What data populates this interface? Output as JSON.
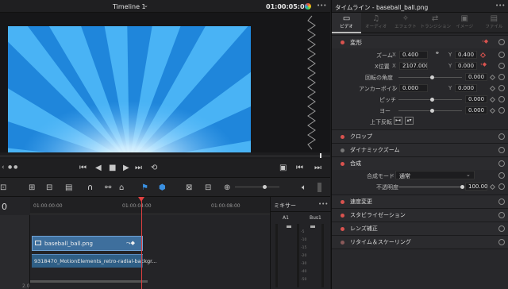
{
  "viewer": {
    "timeline_name": "Timeline 1",
    "timecode": "01:00:05:00",
    "more": "•••"
  },
  "transport": {
    "nav_left": "‹",
    "nav_dots": "● ●"
  },
  "timeline": {
    "current_tc": "0",
    "ruler": [
      "01:00:00:00",
      "01:00:04:00",
      "01:00:08:00"
    ],
    "clip_video": "baseball_ball.png",
    "clip_audio": "9318470_MotionElements_retro-radial-backgr...",
    "track_audio_label": "2.0"
  },
  "mixer": {
    "title": "ミキサー",
    "more": "•••",
    "ch1": "A1",
    "ch2": "Bus1",
    "scale": [
      "-5",
      "-10",
      "-15",
      "-20",
      "-30",
      "-40",
      "-50"
    ]
  },
  "inspector": {
    "title": "タイムライン - baseball_ball.png",
    "more": "•••",
    "tabs": [
      {
        "label": "ビデオ",
        "icon": "video-icon"
      },
      {
        "label": "オーディオ",
        "icon": "audio-icon"
      },
      {
        "label": "エフェクト",
        "icon": "effect-icon"
      },
      {
        "label": "トランジション",
        "icon": "transition-icon"
      },
      {
        "label": "イメージ",
        "icon": "image-icon"
      },
      {
        "label": "ファイル",
        "icon": "file-icon"
      }
    ],
    "transform": {
      "title": "変形",
      "zoom_label": "ズーム",
      "zoom_x_axis": "X",
      "zoom_x": "0.400",
      "zoom_y_axis": "Y",
      "zoom_y": "0.400",
      "pos_label": "X位置",
      "pos_x_axis": "X",
      "pos_x": "2107.000",
      "pos_y_axis": "Y",
      "pos_y": "0.000",
      "rot_label": "回転の角度",
      "rot_val": "0.000",
      "anchor_label": "アンカーポイント",
      "anchor_x_axis": "X",
      "anchor_x": "0.000",
      "anchor_y_axis": "Y",
      "anchor_y": "0.000",
      "pitch_label": "ピッチ",
      "pitch_val": "0.000",
      "yaw_label": "ヨー",
      "yaw_val": "0.000",
      "flip_label": "上下反転"
    },
    "sections": [
      {
        "label": "クロップ"
      },
      {
        "label": "ダイナミックズーム"
      }
    ],
    "composite": {
      "title": "合成",
      "mode_label": "合成モード",
      "mode_value": "通常",
      "opacity_label": "不透明度",
      "opacity_value": "100.00"
    },
    "more_sections": [
      {
        "label": "速度変更"
      },
      {
        "label": "スタビライゼーション"
      },
      {
        "label": "レンズ補正"
      },
      {
        "label": "リタイム＆スケーリング"
      }
    ]
  }
}
